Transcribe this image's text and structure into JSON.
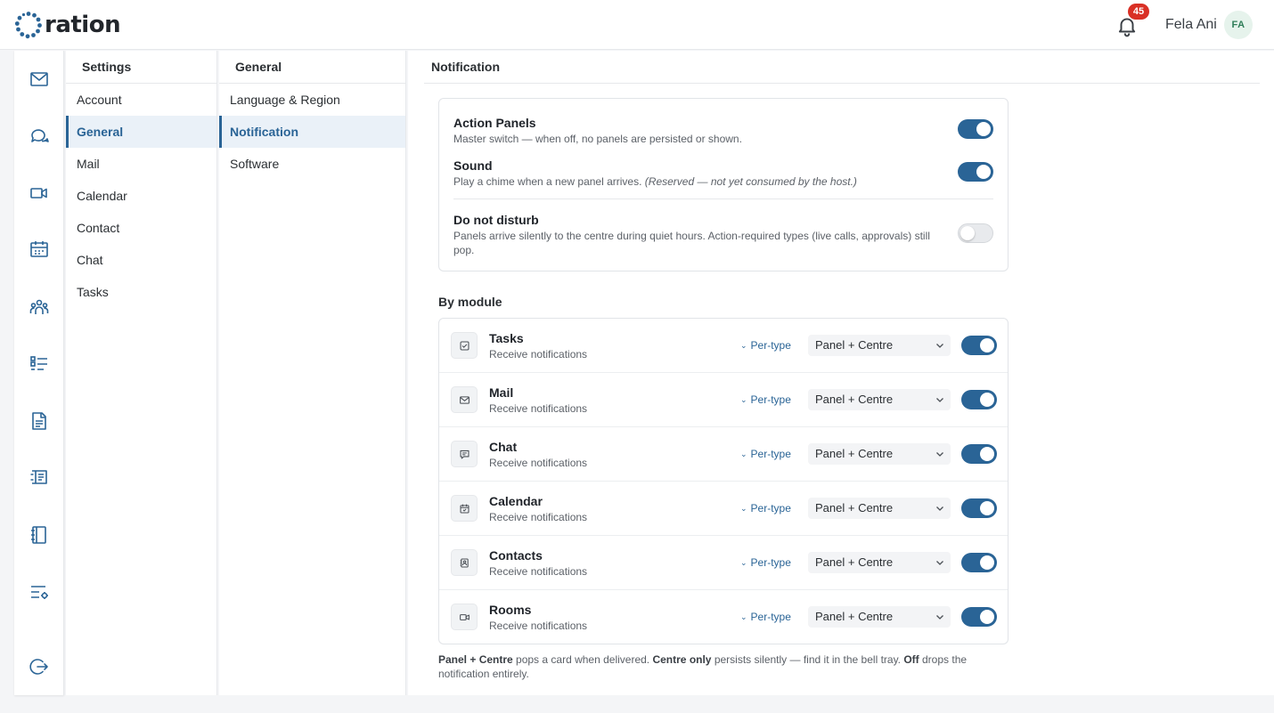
{
  "app": {
    "logo_text": "ration",
    "notification_count": "45",
    "user_name": "Fela Ani",
    "user_initials": "FA"
  },
  "rail": {
    "icons": [
      "mail-icon",
      "chat-icon",
      "video-icon",
      "calendar-icon",
      "contacts-icon",
      "tasks-icon",
      "document-icon",
      "book-icon",
      "notebook-icon",
      "settings-list-icon"
    ],
    "logout_icon": "logout-icon"
  },
  "settings_nav": {
    "title": "Settings",
    "items": [
      {
        "label": "Account",
        "active": false
      },
      {
        "label": "General",
        "active": true
      },
      {
        "label": "Mail",
        "active": false
      },
      {
        "label": "Calendar",
        "active": false
      },
      {
        "label": "Contact",
        "active": false
      },
      {
        "label": "Chat",
        "active": false
      },
      {
        "label": "Tasks",
        "active": false
      }
    ]
  },
  "general_nav": {
    "title": "General",
    "items": [
      {
        "label": "Language & Region",
        "active": false
      },
      {
        "label": "Notification",
        "active": true
      },
      {
        "label": "Software",
        "active": false
      }
    ]
  },
  "notification": {
    "title": "Notification",
    "action_panels": {
      "title": "Action Panels",
      "desc": "Master switch — when off, no panels are persisted or shown.",
      "enabled": true
    },
    "sound": {
      "title": "Sound",
      "desc": "Play a chime when a new panel arrives.",
      "note": "(Reserved — not yet consumed by the host.)",
      "enabled": true
    },
    "dnd": {
      "title": "Do not disturb",
      "desc": "Panels arrive silently to the centre during quiet hours. Action-required types (live calls, approvals) still pop.",
      "enabled": false
    },
    "by_module_label": "By module",
    "per_type_label": "Per-type",
    "modules": [
      {
        "name": "Tasks",
        "sub": "Receive notifications",
        "mode": "Panel + Centre",
        "enabled": true,
        "icon": "task-check-icon"
      },
      {
        "name": "Mail",
        "sub": "Receive notifications",
        "mode": "Panel + Centre",
        "enabled": true,
        "icon": "mail-icon"
      },
      {
        "name": "Chat",
        "sub": "Receive notifications",
        "mode": "Panel + Centre",
        "enabled": true,
        "icon": "chat-icon"
      },
      {
        "name": "Calendar",
        "sub": "Receive notifications",
        "mode": "Panel + Centre",
        "enabled": true,
        "icon": "calendar-icon"
      },
      {
        "name": "Contacts",
        "sub": "Receive notifications",
        "mode": "Panel + Centre",
        "enabled": true,
        "icon": "contacts-icon"
      },
      {
        "name": "Rooms",
        "sub": "Receive notifications",
        "mode": "Panel + Centre",
        "enabled": true,
        "icon": "video-icon"
      }
    ],
    "footnote": {
      "b1": "Panel + Centre",
      "t1": " pops a card when delivered. ",
      "b2": "Centre only",
      "t2": " persists silently — find it in the bell tray. ",
      "b3": "Off",
      "t3": " drops the notification entirely."
    }
  },
  "colors": {
    "accent": "#2a6496",
    "badge": "#d93025",
    "avatar_bg": "#e6f3ec",
    "avatar_text": "#2f7d58"
  }
}
